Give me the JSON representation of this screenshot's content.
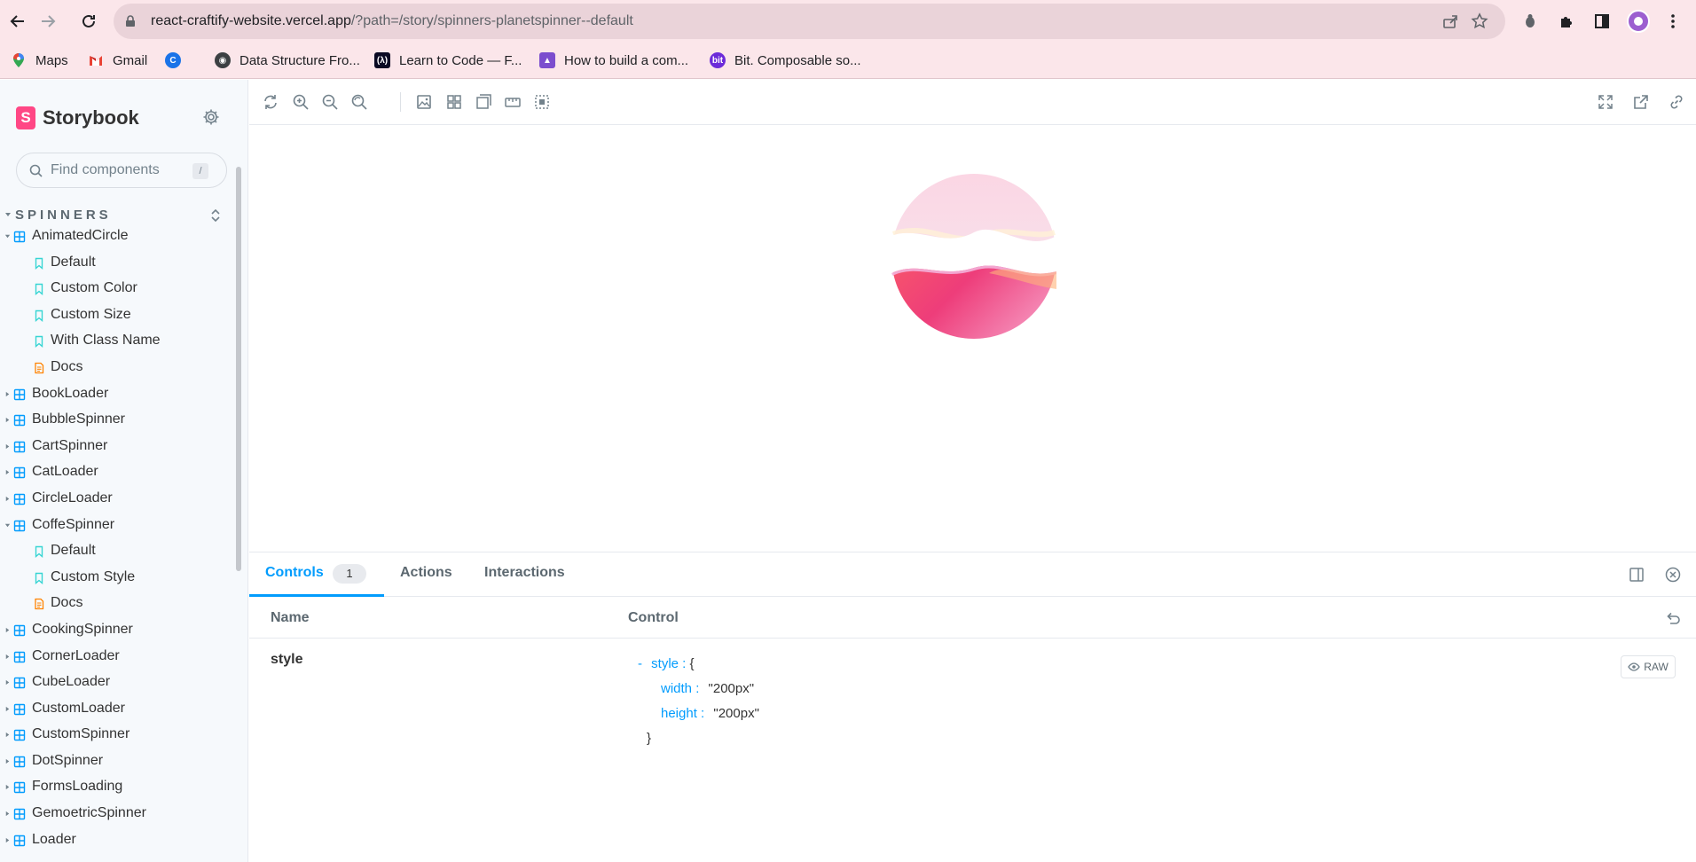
{
  "browser": {
    "url_host": "react-craftify-website.vercel.app",
    "url_path": "/?path=/story/spinners-planetspinner--default",
    "bookmarks": [
      {
        "label": "Maps",
        "icon": "maps-icon"
      },
      {
        "label": "Gmail",
        "icon": "gmail-icon"
      },
      {
        "label": "",
        "icon": "c-icon"
      },
      {
        "label": "Data Structure Fro...",
        "icon": "globe-icon"
      },
      {
        "label": "Learn to Code — F...",
        "icon": "fcc-icon"
      },
      {
        "label": "How to build a com...",
        "icon": "rocket-icon"
      },
      {
        "label": "Bit. Composable so...",
        "icon": "bit-icon"
      }
    ],
    "colors": {
      "chrome": "#fbe6ea",
      "omnibox": "#ead3d9",
      "avatar": "#9c5fd0"
    }
  },
  "sidebar": {
    "brand": "Storybook",
    "search_placeholder": "Find components",
    "search_shortcut": "/",
    "section_title": "SPINNERS",
    "items": [
      {
        "label": "AnimatedCircle",
        "type": "component",
        "expanded": true
      },
      {
        "label": "Default",
        "type": "story"
      },
      {
        "label": "Custom Color",
        "type": "story"
      },
      {
        "label": "Custom Size",
        "type": "story"
      },
      {
        "label": "With Class Name",
        "type": "story"
      },
      {
        "label": "Docs",
        "type": "docs"
      },
      {
        "label": "BookLoader",
        "type": "component",
        "expanded": false
      },
      {
        "label": "BubbleSpinner",
        "type": "component",
        "expanded": false
      },
      {
        "label": "CartSpinner",
        "type": "component",
        "expanded": false
      },
      {
        "label": "CatLoader",
        "type": "component",
        "expanded": false
      },
      {
        "label": "CircleLoader",
        "type": "component",
        "expanded": false
      },
      {
        "label": "CoffeSpinner",
        "type": "component",
        "expanded": true
      },
      {
        "label": "Default",
        "type": "story"
      },
      {
        "label": "Custom Style",
        "type": "story"
      },
      {
        "label": "Docs",
        "type": "docs"
      },
      {
        "label": "CookingSpinner",
        "type": "component",
        "expanded": false
      },
      {
        "label": "CornerLoader",
        "type": "component",
        "expanded": false
      },
      {
        "label": "CubeLoader",
        "type": "component",
        "expanded": false
      },
      {
        "label": "CustomLoader",
        "type": "component",
        "expanded": false
      },
      {
        "label": "CustomSpinner",
        "type": "component",
        "expanded": false
      },
      {
        "label": "DotSpinner",
        "type": "component",
        "expanded": false
      },
      {
        "label": "FormsLoading",
        "type": "component",
        "expanded": false
      },
      {
        "label": "GemoetricSpinner",
        "type": "component",
        "expanded": false
      },
      {
        "label": "Loader",
        "type": "component",
        "expanded": false
      }
    ],
    "colors": {
      "brand": "#ff4785",
      "component_icon": "#029cfd",
      "story_icon": "#37d5d3",
      "docs_icon": "#ff8300"
    }
  },
  "panel": {
    "tabs": [
      {
        "label": "Controls",
        "badge": "1",
        "active": true
      },
      {
        "label": "Actions"
      },
      {
        "label": "Interactions"
      }
    ],
    "columns": {
      "name": "Name",
      "control": "Control"
    },
    "control_row": {
      "name": "style",
      "json": {
        "toggle": "-",
        "root_key": "style",
        "open_brace": "{",
        "close_brace": "}",
        "props": [
          {
            "key": "width",
            "value": "\"200px\""
          },
          {
            "key": "height",
            "value": "\"200px\""
          }
        ]
      },
      "raw_label": "RAW"
    },
    "accent": "#029cfd"
  }
}
